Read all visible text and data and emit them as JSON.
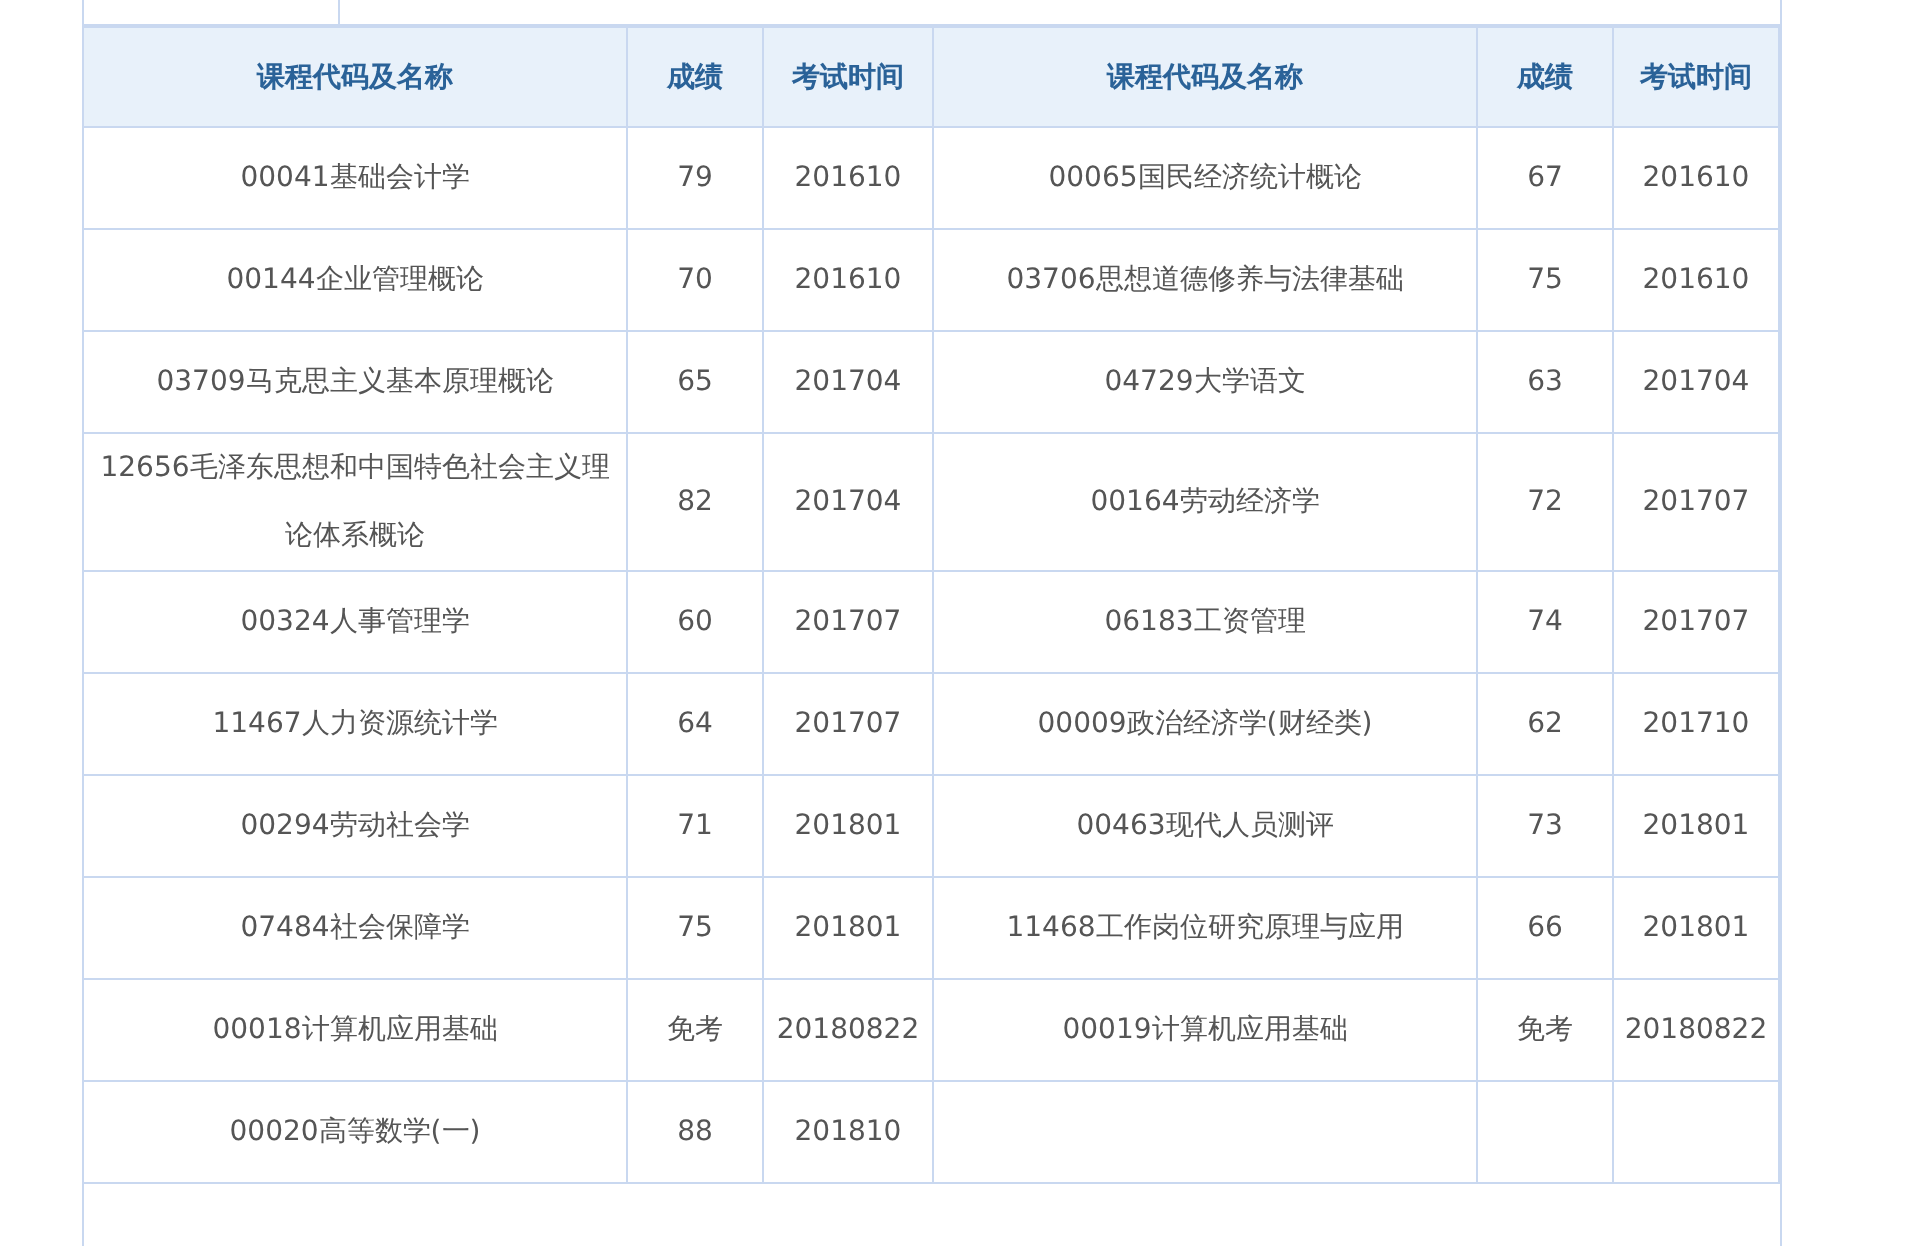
{
  "table": {
    "columns": [
      "课程代码及名称",
      "成绩",
      "考试时间",
      "课程代码及名称",
      "成绩",
      "考试时间"
    ],
    "rows": [
      {
        "courses": [
          {
            "name": "00041基础会计学",
            "score": "79",
            "date": "201610"
          },
          {
            "name": "00065国民经济统计概论",
            "score": "67",
            "date": "201610"
          }
        ]
      },
      {
        "courses": [
          {
            "name": "00144企业管理概论",
            "score": "70",
            "date": "201610"
          },
          {
            "name": "03706思想道德修养与法律基础",
            "score": "75",
            "date": "201610"
          }
        ]
      },
      {
        "courses": [
          {
            "name": "03709马克思主义基本原理概论",
            "score": "65",
            "date": "201704"
          },
          {
            "name": "04729大学语文",
            "score": "63",
            "date": "201704"
          }
        ]
      },
      {
        "courses": [
          {
            "name": "12656毛泽东思想和中国特色社会主义理论体系概论",
            "score": "82",
            "date": "201704"
          },
          {
            "name": "00164劳动经济学",
            "score": "72",
            "date": "201707"
          }
        ]
      },
      {
        "courses": [
          {
            "name": "00324人事管理学",
            "score": "60",
            "date": "201707"
          },
          {
            "name": "06183工资管理",
            "score": "74",
            "date": "201707"
          }
        ]
      },
      {
        "courses": [
          {
            "name": "11467人力资源统计学",
            "score": "64",
            "date": "201707"
          },
          {
            "name": "00009政治经济学(财经类)",
            "score": "62",
            "date": "201710"
          }
        ]
      },
      {
        "courses": [
          {
            "name": "00294劳动社会学",
            "score": "71",
            "date": "201801"
          },
          {
            "name": "00463现代人员测评",
            "score": "73",
            "date": "201801"
          }
        ]
      },
      {
        "courses": [
          {
            "name": "07484社会保障学",
            "score": "75",
            "date": "201801"
          },
          {
            "name": "11468工作岗位研究原理与应用",
            "score": "66",
            "date": "201801"
          }
        ]
      },
      {
        "courses": [
          {
            "name": "00018计算机应用基础",
            "score": "免考",
            "date": "20180822"
          },
          {
            "name": "00019计算机应用基础",
            "score": "免考",
            "date": "20180822"
          }
        ]
      },
      {
        "courses": [
          {
            "name": "00020高等数学(一)",
            "score": "88",
            "date": "201810"
          }
        ]
      }
    ]
  }
}
